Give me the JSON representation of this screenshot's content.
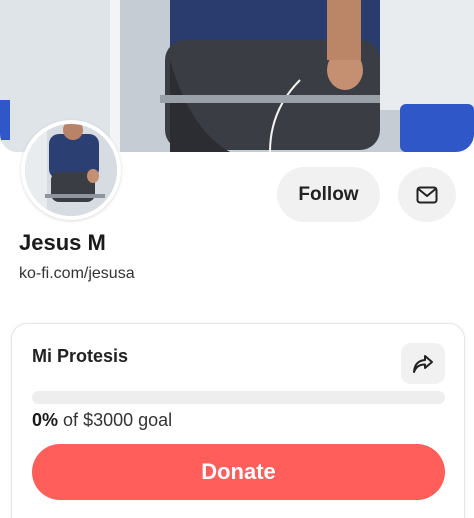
{
  "profile": {
    "name": "Jesus M",
    "url": "ko-fi.com/jesusa",
    "follow_label": "Follow"
  },
  "goal": {
    "title": "Mi Protesis",
    "percent_label": "0%",
    "of_label": "of",
    "amount_label": "$3000 goal",
    "progress_fraction": 0
  },
  "actions": {
    "donate_label": "Donate"
  },
  "icons": {
    "mail": "mail-icon",
    "share": "share-icon"
  },
  "colors": {
    "accent": "#ff5e5b",
    "button_bg": "#f1f1f1"
  }
}
